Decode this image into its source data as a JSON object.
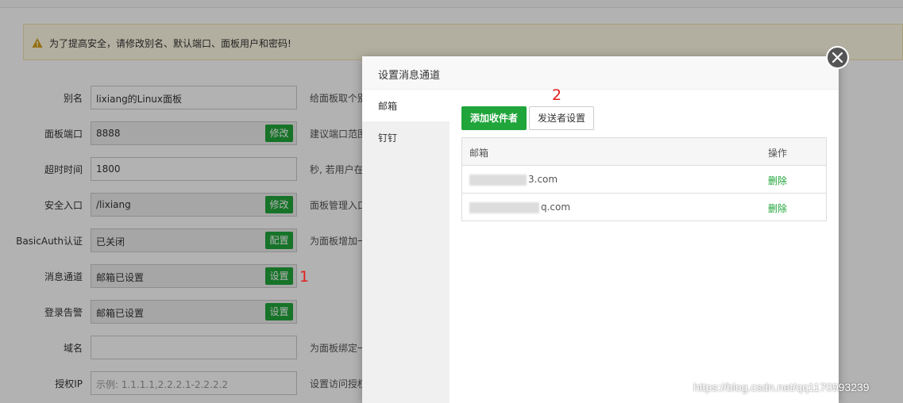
{
  "warning": {
    "text": "为了提高安全，请修改别名、默认端口、面板用户和密码!"
  },
  "settings": [
    {
      "label": "别名",
      "value": "lixiang的Linux面板",
      "readonly": false,
      "button": "",
      "help": "给面板取个别"
    },
    {
      "label": "面板端口",
      "value": "8888",
      "readonly": true,
      "button": "修改",
      "help": "建议端口范围"
    },
    {
      "label": "超时时间",
      "value": "1800",
      "readonly": false,
      "button": "",
      "help": "秒, 若用户在"
    },
    {
      "label": "安全入口",
      "value": "/lixiang",
      "readonly": true,
      "button": "修改",
      "help": "面板管理入口"
    },
    {
      "label": "BasicAuth认证",
      "value": "已关闭",
      "readonly": true,
      "button": "配置",
      "help": "为面板增加一"
    },
    {
      "label": "消息通道",
      "value": "邮箱已设置",
      "readonly": true,
      "button": "设置",
      "help": ""
    },
    {
      "label": "登录告警",
      "value": "邮箱已设置",
      "readonly": true,
      "button": "设置",
      "help": ""
    },
    {
      "label": "域名",
      "value": "",
      "readonly": false,
      "button": "",
      "help": "为面板绑定一"
    },
    {
      "label": "授权IP",
      "value": "",
      "placeholder": "示例: 1.1.1.1,2.2.2.1-2.2.2.2",
      "readonly": false,
      "button": "",
      "help": "设置访问授权"
    }
  ],
  "annotations": {
    "one": "1",
    "two": "2"
  },
  "modal": {
    "title": "设置消息通道",
    "side_items": [
      "邮箱",
      "钉钉"
    ],
    "add_button": "添加收件者",
    "sender_button": "发送者设置",
    "table": {
      "headers": [
        "邮箱",
        "操作"
      ],
      "rows": [
        {
          "email_suffix": "3.com",
          "action": "删除"
        },
        {
          "email_suffix": "q.com",
          "action": "删除"
        }
      ]
    }
  },
  "watermark": "https://blog.csdn.net/qq1170993239",
  "colors": {
    "accent": "#20a53a",
    "annotation": "#e0201f"
  },
  "icons": {
    "warning": "warning-triangle-icon",
    "close": "close-icon"
  }
}
